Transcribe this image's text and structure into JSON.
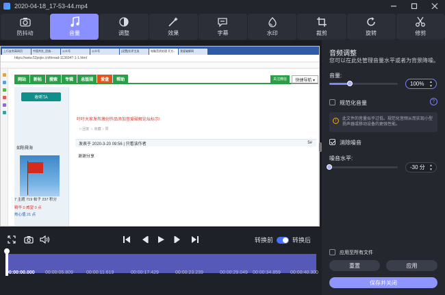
{
  "window": {
    "title": "2020-04-18_17-53-44.mp4"
  },
  "toolbar": {
    "items": [
      {
        "label": "防抖动",
        "icon": "camera-icon"
      },
      {
        "label": "音量",
        "icon": "music-note-icon",
        "active": true
      },
      {
        "label": "调整",
        "icon": "contrast-icon"
      },
      {
        "label": "效果",
        "icon": "magic-wand-icon"
      },
      {
        "label": "字幕",
        "icon": "subtitle-bubble-icon"
      },
      {
        "label": "水印",
        "icon": "watermark-icon"
      },
      {
        "label": "裁剪",
        "icon": "crop-icon"
      },
      {
        "label": "旋转",
        "icon": "rotate-icon"
      },
      {
        "label": "修剪",
        "icon": "scissors-icon"
      }
    ]
  },
  "preview": {
    "browser_tabs": [
      "上行友利高网页",
      "中国共社_民族...",
      "公众号",
      "公众号",
      "[设置]社评主选",
      "电脑音质处理 开方...",
      "我爱破解网"
    ],
    "url": "https://www.52pojie.cn/thread-1136047-1-1.html",
    "nav": [
      "网站",
      "新帖",
      "搜索",
      "专辑",
      "总版规",
      "爱盘",
      "帮助"
    ],
    "follow_label": "关注微信",
    "quick_nav": "快捷导航 ▾",
    "collect": "收听TA",
    "notice": "吁吁大家发布激创作品添加音爱破解论坛标示!",
    "gray_row": "□ 回复   ☆ 收藏   ○ 赞",
    "post_meta": "发表于 2020-3-20 09:56 | 只看该作者",
    "floor": "5#",
    "post_body": "谢谢分享",
    "user_name": "如陈舜海",
    "stats": "7 主题   719 帖子   237 积分",
    "info1": "精华 0   威望 0 点",
    "info2": "热心值 21 点"
  },
  "controls": {
    "before_label": "转换前",
    "after_label": "转换后"
  },
  "timeline": {
    "ticks": [
      "00:00:00.000",
      "00:00:05.809",
      "00:00:11.619",
      "00:00:17.429",
      "00:00:23.239",
      "00:00:29.049",
      "00:00:34.859",
      "00:00:40.300"
    ],
    "playhead_fraction": 0.0
  },
  "panel": {
    "title": "音频调整",
    "desc": "您可以在此处管理音量水平或者为背景降噪。",
    "volume_label": "音量:",
    "volume_value": "100%",
    "volume_level": 0.3,
    "normalize_label": "规范化音量",
    "normalize_checked": false,
    "help_icon": "?",
    "warning_text": "此文件的音量似乎过低。规范化音频从而实现小型扬声器或移动设备的更强性能。",
    "denoise_label": "消除噪音",
    "denoise_checked": true,
    "noise_level_label": "噪音水平:",
    "noise_value": "-30 分",
    "noise_level": 0.0,
    "apply_all_label": "应用至所有文件",
    "reset_label": "重置",
    "apply_label": "应用",
    "save_close_label": "保存并关闭"
  },
  "colors": {
    "accent": "#8a90ff",
    "track": "#5659b8",
    "background": "#1f2129"
  }
}
